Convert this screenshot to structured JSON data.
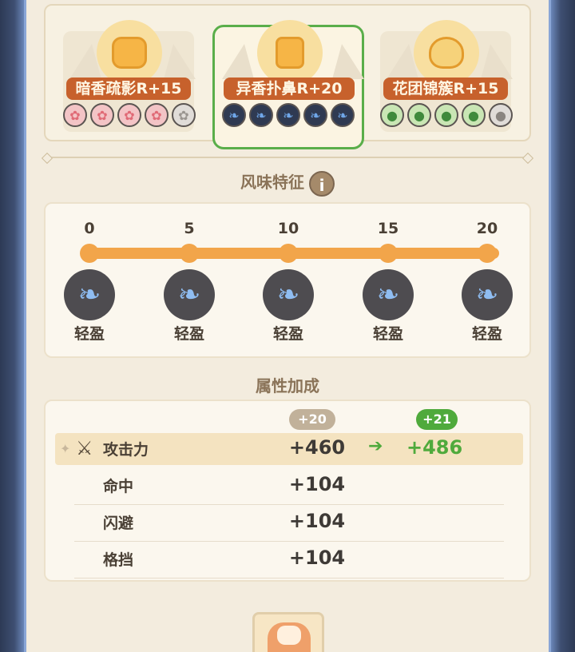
{
  "selector": {
    "cards": [
      {
        "name": "暗香疏影R+15",
        "icon": "cat-face-icon",
        "gems": [
          "flower",
          "flower",
          "flower",
          "flower",
          "flower-dim"
        ]
      },
      {
        "name": "异香扑鼻R+20",
        "icon": "box-face-icon",
        "gems": [
          "wing",
          "wing",
          "wing",
          "wing",
          "wing"
        ],
        "active": true
      },
      {
        "name": "花团锦簇R+15",
        "icon": "fox-tail-icon",
        "gems": [
          "paw",
          "paw",
          "paw",
          "paw",
          "paw-dim"
        ]
      }
    ]
  },
  "flavor": {
    "title": "风味特征",
    "info_icon": "i",
    "scale": [
      "0",
      "5",
      "10",
      "15",
      "20"
    ],
    "traits": [
      "轻盈",
      "轻盈",
      "轻盈",
      "轻盈",
      "轻盈"
    ]
  },
  "attributes": {
    "title": "属性加成",
    "current_bonus": "+20",
    "next_bonus": "+21",
    "rows": [
      {
        "label": "攻击力",
        "value": "+460",
        "new_value": "+486"
      },
      {
        "label": "命中",
        "value": "+104"
      },
      {
        "label": "闪避",
        "value": "+104"
      },
      {
        "label": "格挡",
        "value": "+104"
      }
    ]
  },
  "colors": {
    "accent_green": "#4faa3c",
    "accent_orange": "#f2a54a",
    "name_badge": "#c7612c"
  }
}
